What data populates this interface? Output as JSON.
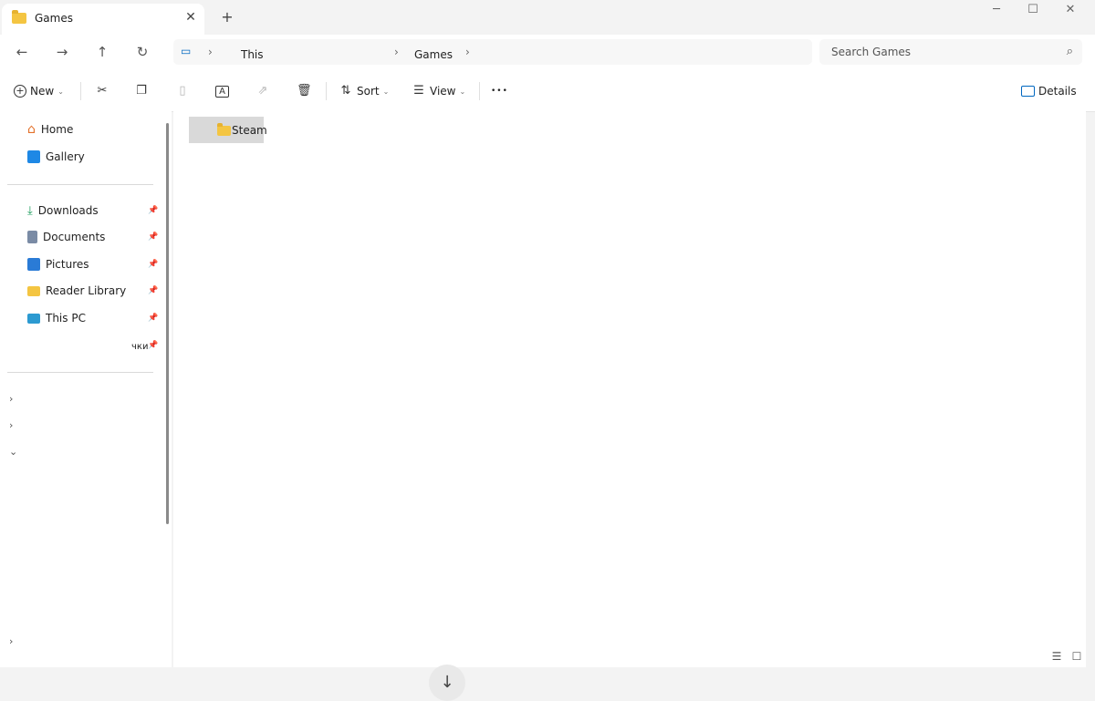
{
  "window": {
    "tab_title": "Games",
    "tab_close_glyph": "✕",
    "new_tab_glyph": "+",
    "minimize_glyph": "─",
    "maximize_glyph": "☐",
    "close_glyph": "✕"
  },
  "nav": {
    "back_glyph": "←",
    "forward_glyph": "→",
    "up_glyph": "↑",
    "refresh_glyph": "↻"
  },
  "address": {
    "breadcrumbs": [
      "This",
      "Games"
    ],
    "separator": "›"
  },
  "search": {
    "placeholder": "Search Games",
    "icon_glyph": "⌕"
  },
  "toolbar": {
    "new_label": "New",
    "sort_label": "Sort",
    "view_label": "View",
    "more_glyph": "•••",
    "details_label": "Details",
    "caret_glyph": "⌄"
  },
  "sidebar": {
    "items": [
      {
        "label": "Home"
      },
      {
        "label": "Gallery"
      },
      {
        "label": "Downloads"
      },
      {
        "label": "Documents"
      },
      {
        "label": "Pictures"
      },
      {
        "label": "Reader Library"
      },
      {
        "label": "This PC"
      }
    ],
    "pinned_fragment": "чки"
  },
  "content": {
    "items": [
      {
        "name": "Steam"
      }
    ]
  },
  "colors": {
    "folder": "#f4c542",
    "accent": "#0067c0",
    "selection": "#d9d9d9"
  }
}
